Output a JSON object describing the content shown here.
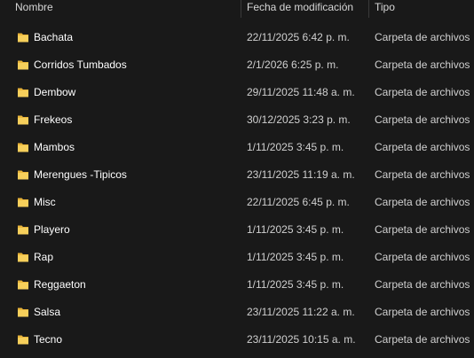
{
  "columns": {
    "name": "Nombre",
    "date": "Fecha de modificación",
    "type": "Tipo"
  },
  "colors": {
    "background": "#191919",
    "folder": "#f0c44b",
    "text": "#ffffff",
    "secondary_text": "#d0d0d0"
  },
  "icon": "folder-icon",
  "rows": [
    {
      "name": "Bachata",
      "date": "22/11/2025 6:42 p. m.",
      "type": "Carpeta de archivos"
    },
    {
      "name": "Corridos Tumbados",
      "date": "2/1/2026 6:25 p. m.",
      "type": "Carpeta de archivos"
    },
    {
      "name": "Dembow",
      "date": "29/11/2025 11:48 a. m.",
      "type": "Carpeta de archivos"
    },
    {
      "name": "Frekeos",
      "date": "30/12/2025 3:23 p. m.",
      "type": "Carpeta de archivos"
    },
    {
      "name": "Mambos",
      "date": "1/11/2025 3:45 p. m.",
      "type": "Carpeta de archivos"
    },
    {
      "name": "Merengues -Tipicos",
      "date": "23/11/2025 11:19 a. m.",
      "type": "Carpeta de archivos"
    },
    {
      "name": "Misc",
      "date": "22/11/2025 6:45 p. m.",
      "type": "Carpeta de archivos"
    },
    {
      "name": "Playero",
      "date": "1/11/2025 3:45 p. m.",
      "type": "Carpeta de archivos"
    },
    {
      "name": "Rap",
      "date": "1/11/2025 3:45 p. m.",
      "type": "Carpeta de archivos"
    },
    {
      "name": "Reggaeton",
      "date": "1/11/2025 3:45 p. m.",
      "type": "Carpeta de archivos"
    },
    {
      "name": "Salsa",
      "date": "23/11/2025 11:22 a. m.",
      "type": "Carpeta de archivos"
    },
    {
      "name": "Tecno",
      "date": "23/11/2025 10:15 a. m.",
      "type": "Carpeta de archivos"
    }
  ]
}
